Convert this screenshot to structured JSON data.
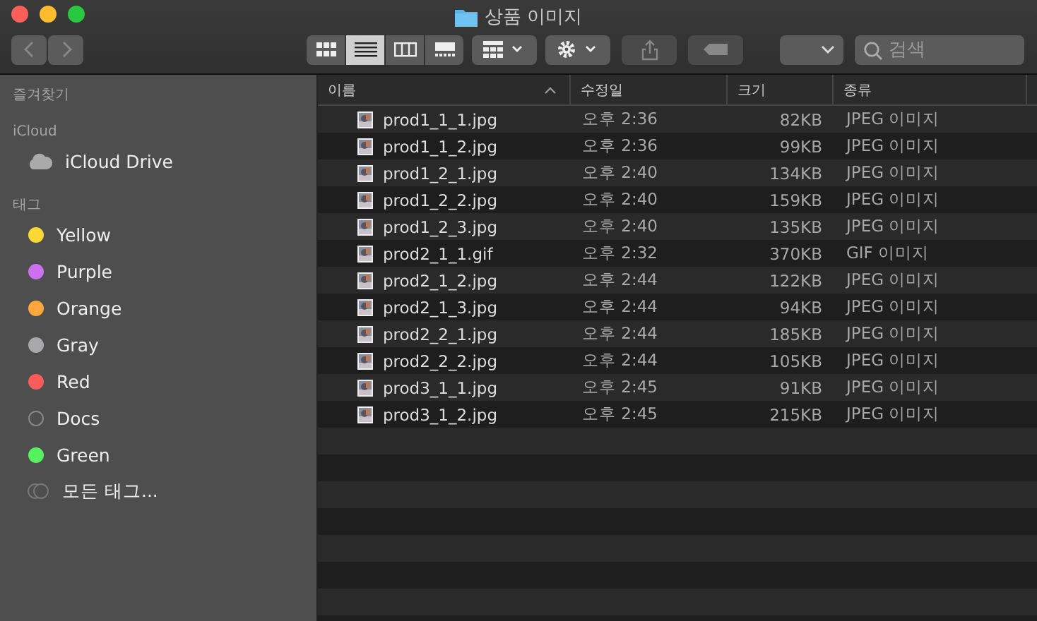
{
  "window": {
    "title": "상품 이미지"
  },
  "toolbar": {
    "view_modes": [
      {
        "kind": "icons",
        "selected": false
      },
      {
        "kind": "list",
        "selected": true
      },
      {
        "kind": "columns",
        "selected": false
      },
      {
        "kind": "gallery",
        "selected": false
      }
    ],
    "search": {
      "placeholder": "검색"
    }
  },
  "sidebar": {
    "sections": [
      {
        "title": "즐겨찾기"
      },
      {
        "title": "iCloud",
        "items": [
          {
            "kind": "cloud",
            "label": "iCloud Drive"
          }
        ]
      },
      {
        "title": "태그",
        "items": [
          {
            "kind": "dot",
            "label": "Yellow",
            "color": "#fbd934"
          },
          {
            "kind": "dot",
            "label": "Purple",
            "color": "#cc70f0"
          },
          {
            "kind": "dot",
            "label": "Orange",
            "color": "#fba73c"
          },
          {
            "kind": "dot",
            "label": "Gray",
            "color": "#a8a8ab"
          },
          {
            "kind": "dot",
            "label": "Red",
            "color": "#fa5c5a"
          },
          {
            "kind": "outline",
            "label": "Docs"
          },
          {
            "kind": "dot",
            "label": "Green",
            "color": "#56f25e"
          },
          {
            "kind": "all",
            "label": "모든 태그..."
          }
        ]
      }
    ]
  },
  "table": {
    "columns": [
      {
        "label": "이름",
        "sorted": true
      },
      {
        "label": "수정일",
        "sorted": false
      },
      {
        "label": "크기",
        "sorted": false
      },
      {
        "label": "종류",
        "sorted": false
      }
    ],
    "rows": [
      {
        "name": "prod1_1_1.jpg",
        "modified": "오후 2:36",
        "size": "82KB",
        "kind": "JPEG 이미지"
      },
      {
        "name": "prod1_1_2.jpg",
        "modified": "오후 2:36",
        "size": "99KB",
        "kind": "JPEG 이미지"
      },
      {
        "name": "prod1_2_1.jpg",
        "modified": "오후 2:40",
        "size": "134KB",
        "kind": "JPEG 이미지"
      },
      {
        "name": "prod1_2_2.jpg",
        "modified": "오후 2:40",
        "size": "159KB",
        "kind": "JPEG 이미지"
      },
      {
        "name": "prod1_2_3.jpg",
        "modified": "오후 2:40",
        "size": "135KB",
        "kind": "JPEG 이미지"
      },
      {
        "name": "prod2_1_1.gif",
        "modified": "오후 2:32",
        "size": "370KB",
        "kind": "GIF 이미지"
      },
      {
        "name": "prod2_1_2.jpg",
        "modified": "오후 2:44",
        "size": "122KB",
        "kind": "JPEG 이미지"
      },
      {
        "name": "prod2_1_3.jpg",
        "modified": "오후 2:44",
        "size": "94KB",
        "kind": "JPEG 이미지"
      },
      {
        "name": "prod2_2_1.jpg",
        "modified": "오후 2:44",
        "size": "185KB",
        "kind": "JPEG 이미지"
      },
      {
        "name": "prod2_2_2.jpg",
        "modified": "오후 2:44",
        "size": "105KB",
        "kind": "JPEG 이미지"
      },
      {
        "name": "prod3_1_1.jpg",
        "modified": "오후 2:45",
        "size": "91KB",
        "kind": "JPEG 이미지"
      },
      {
        "name": "prod3_1_2.jpg",
        "modified": "오후 2:45",
        "size": "215KB",
        "kind": "JPEG 이미지"
      }
    ]
  }
}
